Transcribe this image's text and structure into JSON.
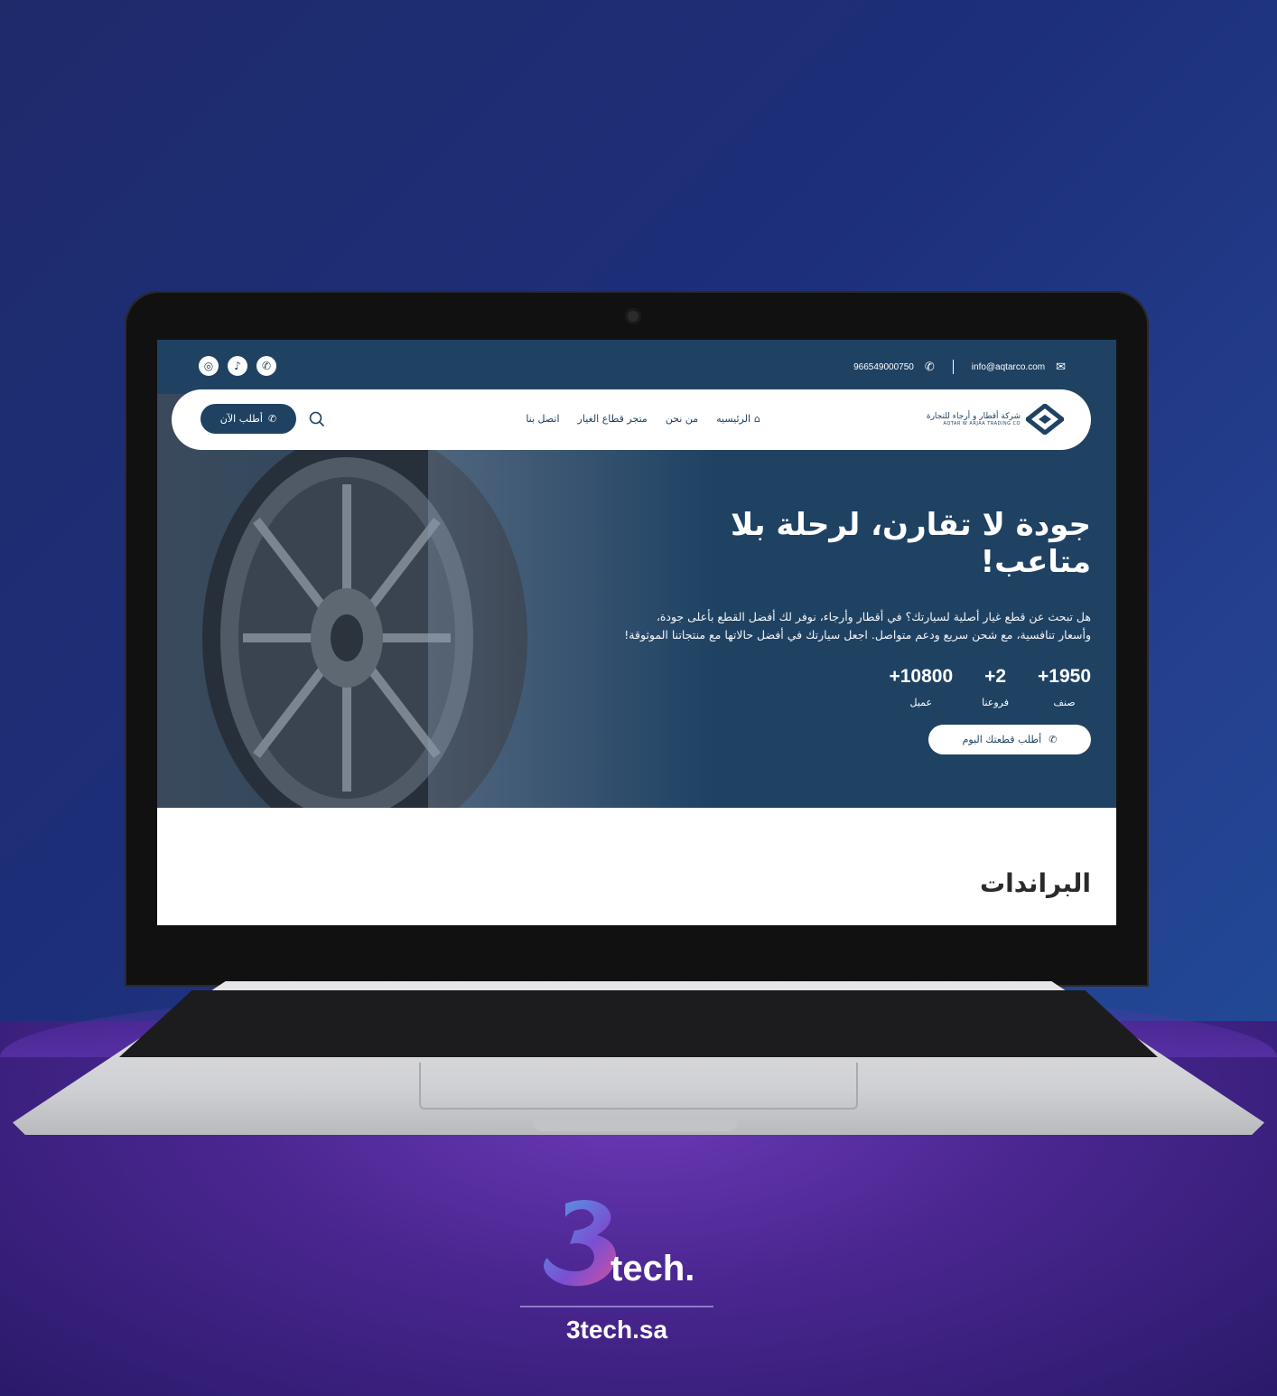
{
  "topbar": {
    "email": "info@aqtarco.com",
    "phone": "966549000750",
    "social_icons": [
      "whatsapp-icon",
      "tiktok-icon",
      "instagram-icon"
    ]
  },
  "navbar": {
    "logo_ar": "شركة أقطار و أرجاء للتجارة",
    "logo_en": "AQTAR W ARJAA TRADING CO",
    "links": [
      "الرئيسيه",
      "من نحن",
      "متجر قطاع الغيار",
      "اتصل بنا"
    ],
    "order_button": "أطلب الآن"
  },
  "hero": {
    "title": "جودة لا تقارن، لرحلة بلا متاعب!",
    "description": "هل تبحث عن قطع غيار أصلية لسيارتك؟ في أقطار وأرجاء، نوفر لك أفضل القطع بأعلى جودة، وأسعار تنافسية، مع شحن سريع ودعم متواصل. اجعل سيارتك في أفضل حالاتها مع منتجاتنا الموثوقة!",
    "stats": [
      {
        "value": "+1950",
        "label": "صنف"
      },
      {
        "value": "+2",
        "label": "فروعنا"
      },
      {
        "value": "+10800",
        "label": "عميل"
      }
    ],
    "cta": "أطلب قطعتك اليوم"
  },
  "brands_title": "البراندات",
  "branding": {
    "logo_text": "tech.",
    "url": "3tech.sa"
  },
  "colors": {
    "primary": "#1f4263",
    "background": "#1f2a6b",
    "accent": "#6d3ab8"
  }
}
